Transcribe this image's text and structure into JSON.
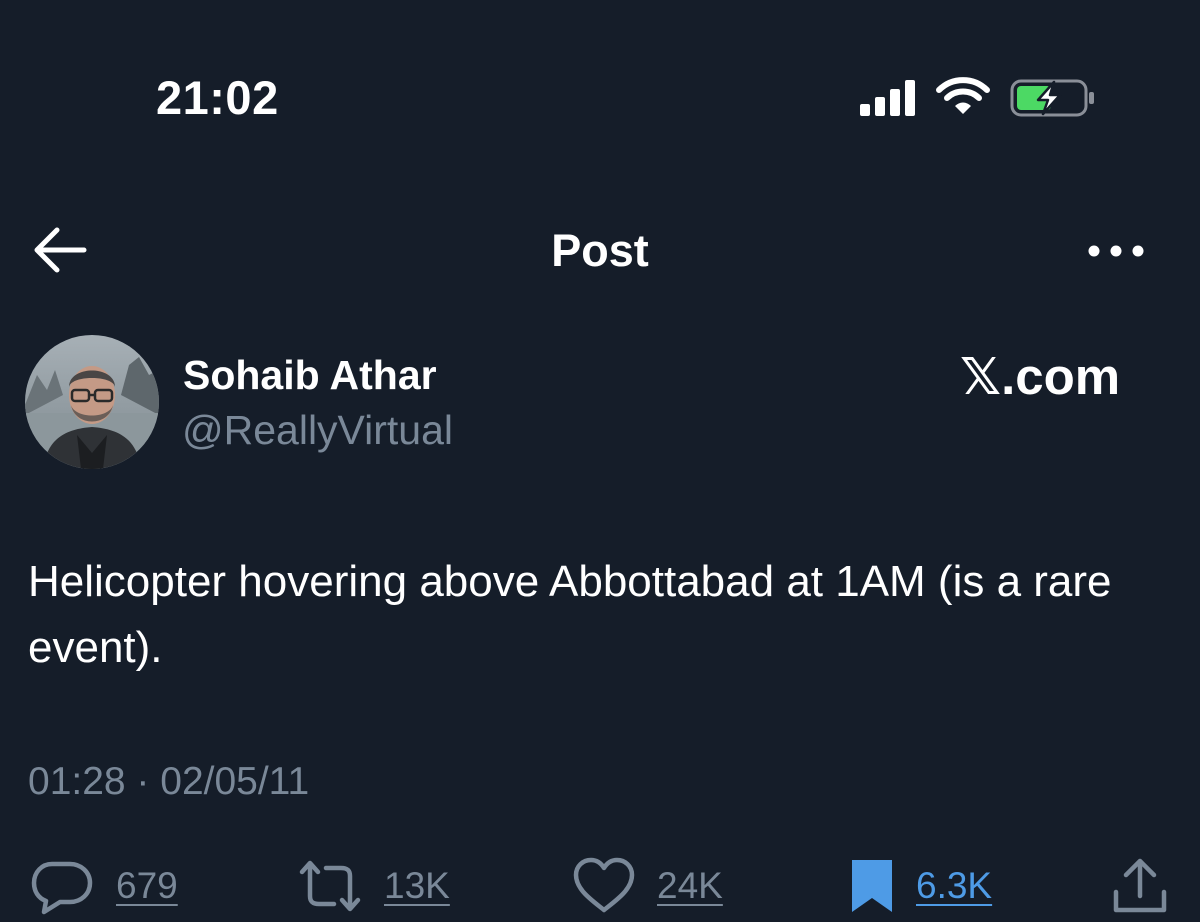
{
  "status_bar": {
    "time": "21:02",
    "icons": [
      "signal-icon",
      "wifi-icon",
      "battery-charging-icon"
    ],
    "battery_color": "#4cd964"
  },
  "nav": {
    "back_icon": "arrow-left-icon",
    "title": "Post",
    "more_icon": "more-horizontal-icon"
  },
  "author": {
    "name": "Sohaib Athar",
    "handle": "@ReallyVirtual"
  },
  "watermark": "𝕏.com",
  "tweet": {
    "text": "Helicopter hovering above Abbottabad at 1AM (is a rare event).",
    "timestamp": "01:28 · 02/05/11"
  },
  "actions": {
    "replies": {
      "icon": "reply-icon",
      "count": "679"
    },
    "reposts": {
      "icon": "repost-icon",
      "count": "13K"
    },
    "likes": {
      "icon": "heart-icon",
      "count": "24K"
    },
    "bookmarks": {
      "icon": "bookmark-filled-icon",
      "count": "6.3K",
      "active": true
    },
    "share": {
      "icon": "share-icon"
    }
  },
  "colors": {
    "background": "#151d29",
    "text": "#ffffff",
    "muted": "#7a8898",
    "accent": "#4e9be6"
  }
}
